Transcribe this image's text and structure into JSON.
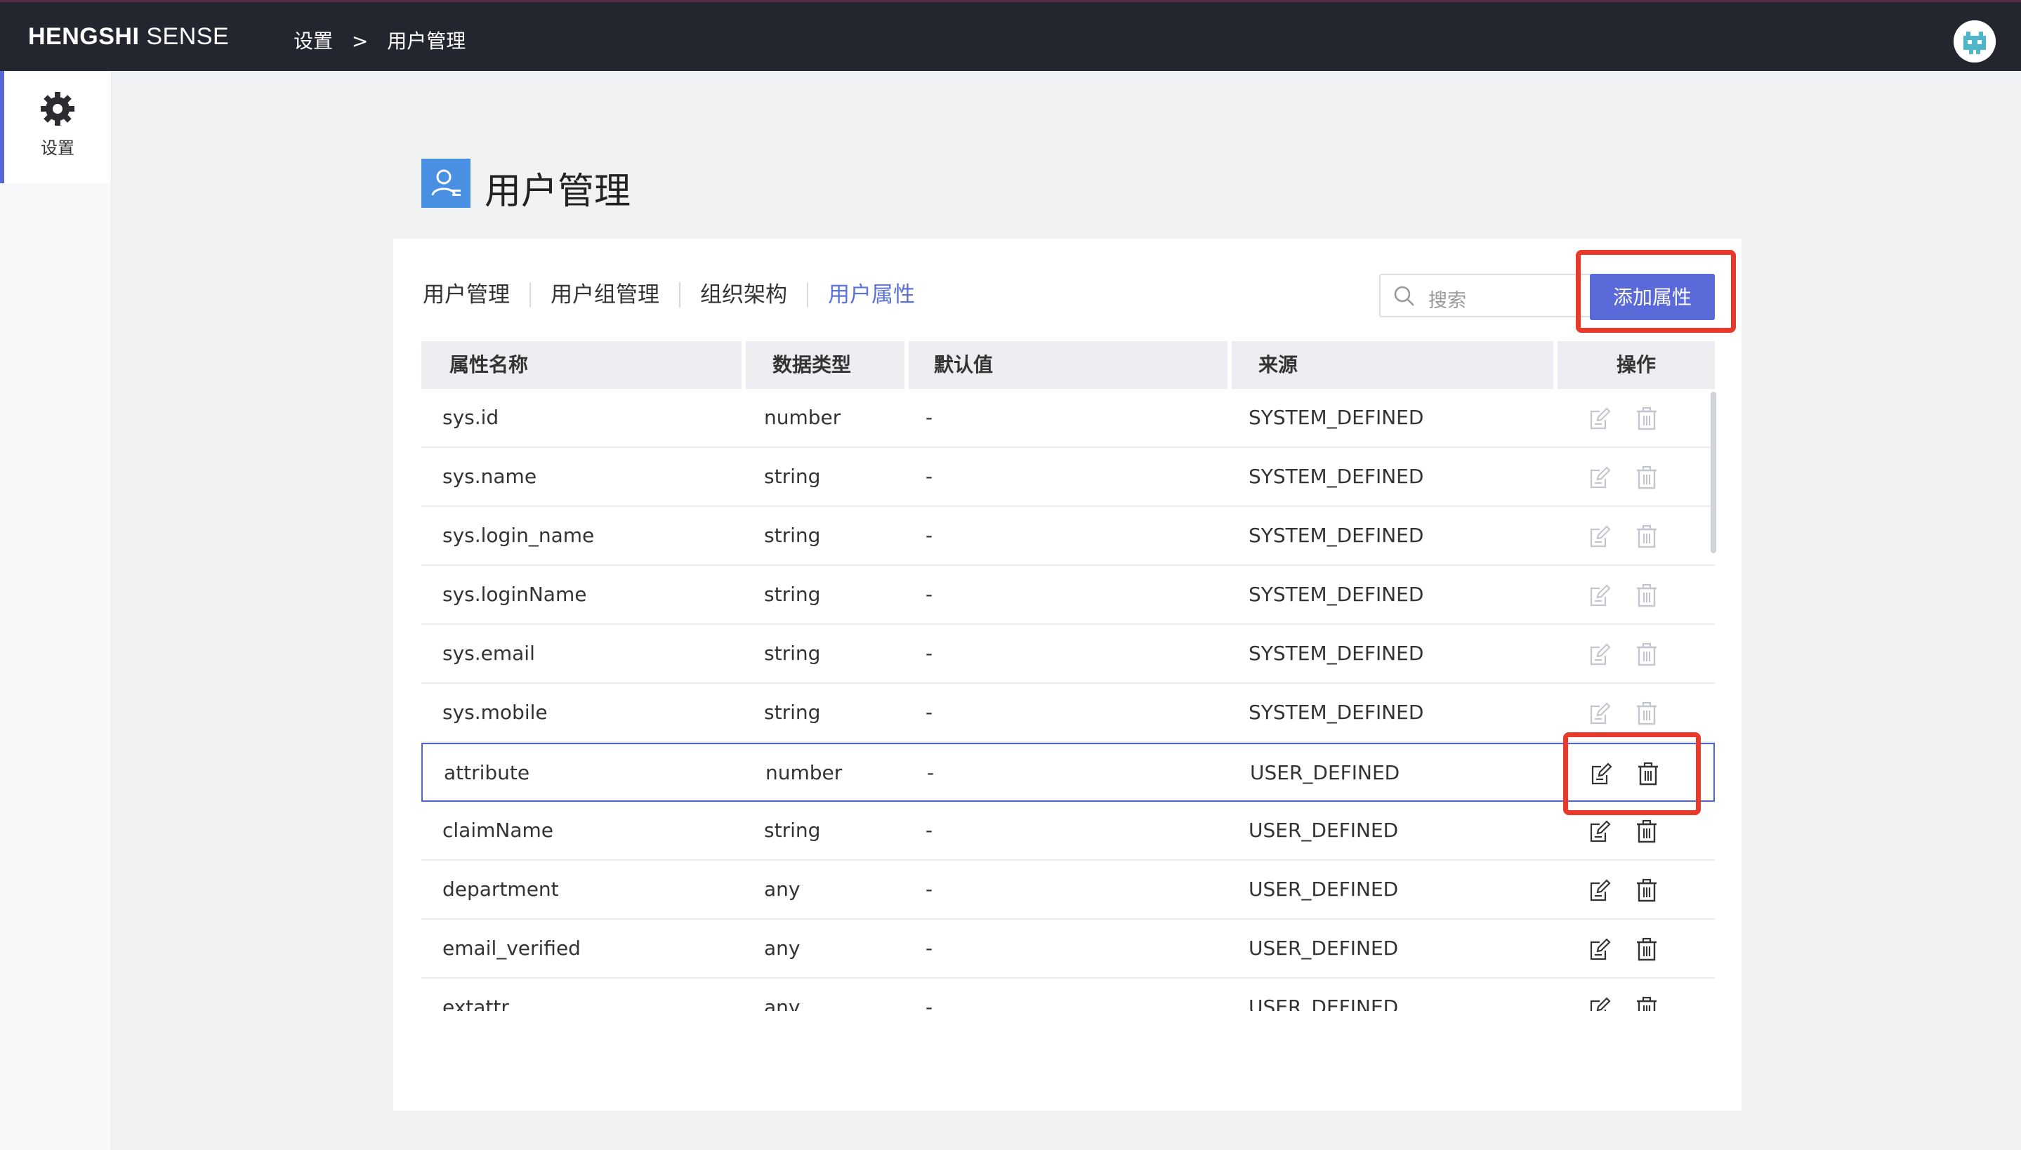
{
  "app": {
    "brand_bold": "HENGSHI",
    "brand_rest": " SENSE",
    "breadcrumb": [
      "设置",
      "用户管理"
    ],
    "breadcrumb_sep": ">"
  },
  "sidebar": {
    "items": [
      {
        "label": "设置",
        "icon": "gear-icon",
        "active": true
      }
    ]
  },
  "page": {
    "title": "用户管理",
    "icon": "user-card-icon"
  },
  "tabs": [
    {
      "label": "用户管理",
      "active": false
    },
    {
      "label": "用户组管理",
      "active": false
    },
    {
      "label": "组织架构",
      "active": false
    },
    {
      "label": "用户属性",
      "active": true
    }
  ],
  "search": {
    "placeholder": "搜索"
  },
  "toolbar": {
    "add_label": "添加属性"
  },
  "table": {
    "columns": [
      "属性名称",
      "数据类型",
      "默认值",
      "来源",
      "操作"
    ],
    "rows": [
      {
        "name": "sys.id",
        "type": "number",
        "default": "-",
        "source": "SYSTEM_DEFINED",
        "editable": false
      },
      {
        "name": "sys.name",
        "type": "string",
        "default": "-",
        "source": "SYSTEM_DEFINED",
        "editable": false
      },
      {
        "name": "sys.login_name",
        "type": "string",
        "default": "-",
        "source": "SYSTEM_DEFINED",
        "editable": false
      },
      {
        "name": "sys.loginName",
        "type": "string",
        "default": "-",
        "source": "SYSTEM_DEFINED",
        "editable": false
      },
      {
        "name": "sys.email",
        "type": "string",
        "default": "-",
        "source": "SYSTEM_DEFINED",
        "editable": false
      },
      {
        "name": "sys.mobile",
        "type": "string",
        "default": "-",
        "source": "SYSTEM_DEFINED",
        "editable": false
      },
      {
        "name": "attribute",
        "type": "number",
        "default": "-",
        "source": "USER_DEFINED",
        "editable": true,
        "selected": true
      },
      {
        "name": "claimName",
        "type": "string",
        "default": "-",
        "source": "USER_DEFINED",
        "editable": true
      },
      {
        "name": "department",
        "type": "any",
        "default": "-",
        "source": "USER_DEFINED",
        "editable": true
      },
      {
        "name": "email_verified",
        "type": "any",
        "default": "-",
        "source": "USER_DEFINED",
        "editable": true
      },
      {
        "name": "extattr",
        "type": "any",
        "default": "-",
        "source": "USER_DEFINED",
        "editable": true
      }
    ]
  },
  "colors": {
    "accent": "#5b6ad9",
    "highlight": "#e8392a",
    "topbar": "#23262f",
    "disabled_icon": "#c3c6cc",
    "enabled_icon": "#333333"
  }
}
